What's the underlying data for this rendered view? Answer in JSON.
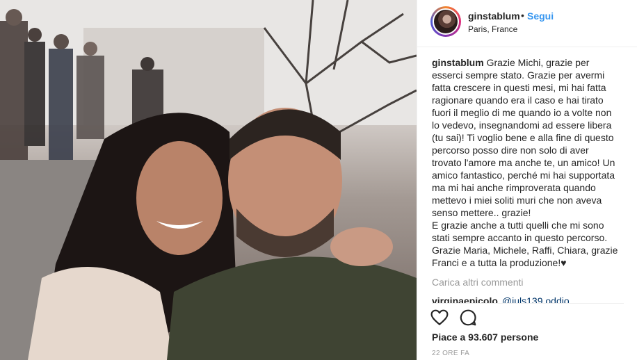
{
  "post": {
    "username": "ginstablum",
    "separator": "•",
    "follow_label": "Segui",
    "location": "Paris, France",
    "caption_user": "ginstablum",
    "caption_text": "Grazie Michi, grazie per esserci sempre stato. Grazie per avermi fatta crescere in questi mesi, mi hai fatta ragionare quando era il caso e hai tirato fuori il meglio di me quando io a volte non lo vedevo, insegnandomi ad essere libera (tu sai)! Ti voglio bene e alla fine di questo percorso posso dire non solo di aver trovato l'amore ma anche te, un amico! Un amico fantastico, perché mi hai supportata ma mi hai anche rimproverata quando mettevo i miei soliti muri che non aveva senso mettere.. grazie!\nE grazie anche a tutti quelli che mi sono stati sempre accanto in questo percorso. Grazie Maria, Michele, Raffi, Chiara, grazie Franci e a tutta la produzione!♥",
    "load_more_label": "Carica altri commenti",
    "partial_comment_user": "virginaepicolo",
    "partial_comment_mention": "@juls139 oddio",
    "likes_label": "Piace a 93.607 persone",
    "time_ago": "22 ORE FA",
    "icons": {
      "like": "heart-icon",
      "comment": "comment-bubble-icon"
    }
  }
}
